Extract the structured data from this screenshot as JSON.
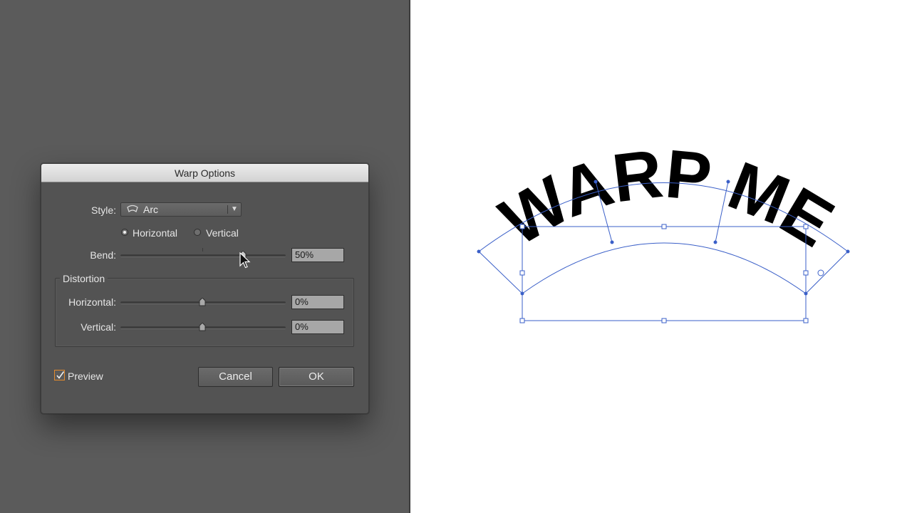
{
  "dialog": {
    "title": "Warp Options",
    "style_label": "Style:",
    "style_value": "Arc",
    "style_icon": "arc-warp-icon",
    "orientation": {
      "horizontal_label": "Horizontal",
      "vertical_label": "Vertical",
      "selected": "Horizontal"
    },
    "bend": {
      "label": "Bend:",
      "value": "50%",
      "level_percent": 50
    },
    "distortion": {
      "title": "Distortion",
      "horizontal": {
        "label": "Horizontal:",
        "value": "0%",
        "level_percent": 0
      },
      "vertical": {
        "label": "Vertical:",
        "value": "0%",
        "level_percent": 0
      }
    },
    "preview": {
      "label": "Preview",
      "checked": true
    },
    "buttons": {
      "cancel": "Cancel",
      "ok": "OK"
    }
  },
  "artwork": {
    "text": "WARP ME"
  },
  "colors": {
    "selection": "#3a5fc8",
    "checkbox_accent": "#e28a2d",
    "pasteboard": "#5b5b5b",
    "artboard": "#ffffff"
  }
}
